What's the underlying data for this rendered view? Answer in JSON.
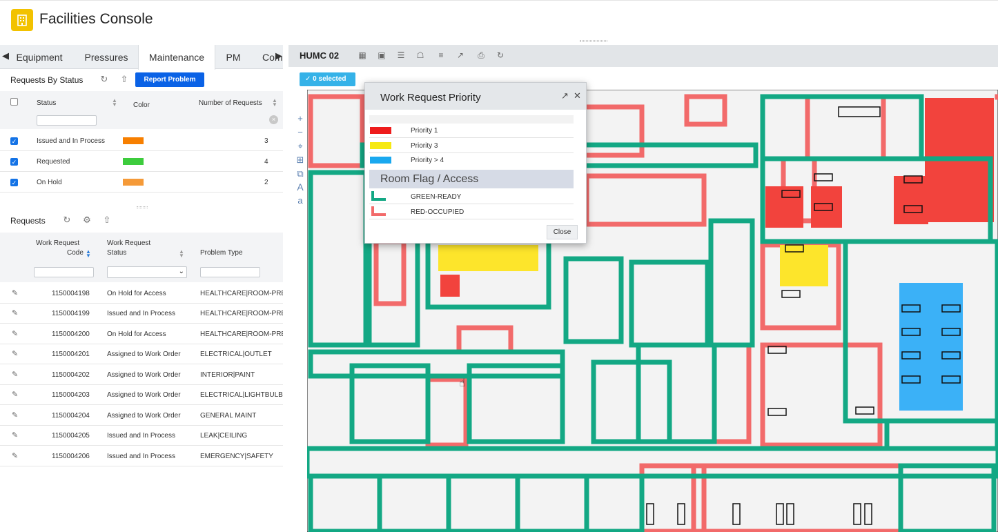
{
  "app": {
    "title": "Facilities Console",
    "icon": "building-icon",
    "accent": "#f2c200"
  },
  "tabs": {
    "items": [
      "Equipment",
      "Pressures",
      "Maintenance",
      "PM",
      "Comp"
    ],
    "active": "Maintenance"
  },
  "status_panel": {
    "title": "Requests By Status",
    "report_button": "Report Problem",
    "columns": {
      "status": "Status",
      "color": "Color",
      "count": "Number of Requests"
    },
    "rows": [
      {
        "status": "Issued and In Process",
        "color": "#f77f00",
        "count": "3",
        "checked": true
      },
      {
        "status": "Requested",
        "color": "#3dcc3d",
        "count": "4",
        "checked": true
      },
      {
        "status": "On Hold",
        "color": "#f59a38",
        "count": "2",
        "checked": true
      }
    ]
  },
  "requests_panel": {
    "title": "Requests",
    "columns": {
      "code_l1": "Work Request",
      "code_l2": "Code",
      "status_l1": "Work Request",
      "status_l2": "Status",
      "problem": "Problem Type"
    },
    "rows": [
      {
        "code": "1150004198",
        "status": "On Hold for Access",
        "problem": "HEALTHCARE|ROOM-PREP"
      },
      {
        "code": "1150004199",
        "status": "Issued and In Process",
        "problem": "HEALTHCARE|ROOM-PREP"
      },
      {
        "code": "1150004200",
        "status": "On Hold for Access",
        "problem": "HEALTHCARE|ROOM-PREP"
      },
      {
        "code": "1150004201",
        "status": "Assigned to Work Order",
        "problem": "ELECTRICAL|OUTLET"
      },
      {
        "code": "1150004202",
        "status": "Assigned to Work Order",
        "problem": "INTERIOR|PAINT"
      },
      {
        "code": "1150004203",
        "status": "Assigned to Work Order",
        "problem": "ELECTRICAL|LIGHTBULB"
      },
      {
        "code": "1150004204",
        "status": "Assigned to Work Order",
        "problem": "GENERAL MAINT"
      },
      {
        "code": "1150004205",
        "status": "Issued and In Process",
        "problem": "LEAK|CEILING"
      },
      {
        "code": "1150004206",
        "status": "Issued and In Process",
        "problem": "EMERGENCY|SAFETY"
      }
    ]
  },
  "drawing": {
    "title": "HUMC 02",
    "selected": "0 selected",
    "tools": [
      "grid-icon",
      "grid-outline-icon",
      "list-icon",
      "tag-icon",
      "layers-icon",
      "collapse-icon",
      "print-icon",
      "refresh-icon"
    ],
    "side_tools": [
      "zoom-in-icon",
      "zoom-out-icon",
      "locate-icon",
      "crop-icon",
      "copy-icon",
      "text-large-icon",
      "text-small-icon"
    ],
    "colors": {
      "ready": "#13a884",
      "occupied": "#f26a6a",
      "p1": "#f2433d",
      "p3": "#fde52b",
      "p4": "#3bb1f7"
    }
  },
  "legend": {
    "title": "Work Request Priority",
    "priorities": [
      {
        "label": "Priority 1",
        "color": "#ee1c1c"
      },
      {
        "label": "Priority 3",
        "color": "#f6e912"
      },
      {
        "label": "Priority > 4",
        "color": "#19a8ef"
      }
    ],
    "group_title": "Room Flag / Access",
    "flags": [
      {
        "label": "GREEN-READY",
        "color": "#13a884"
      },
      {
        "label": "RED-OCCUPIED",
        "color": "#f26a6a"
      }
    ],
    "close": "Close"
  }
}
